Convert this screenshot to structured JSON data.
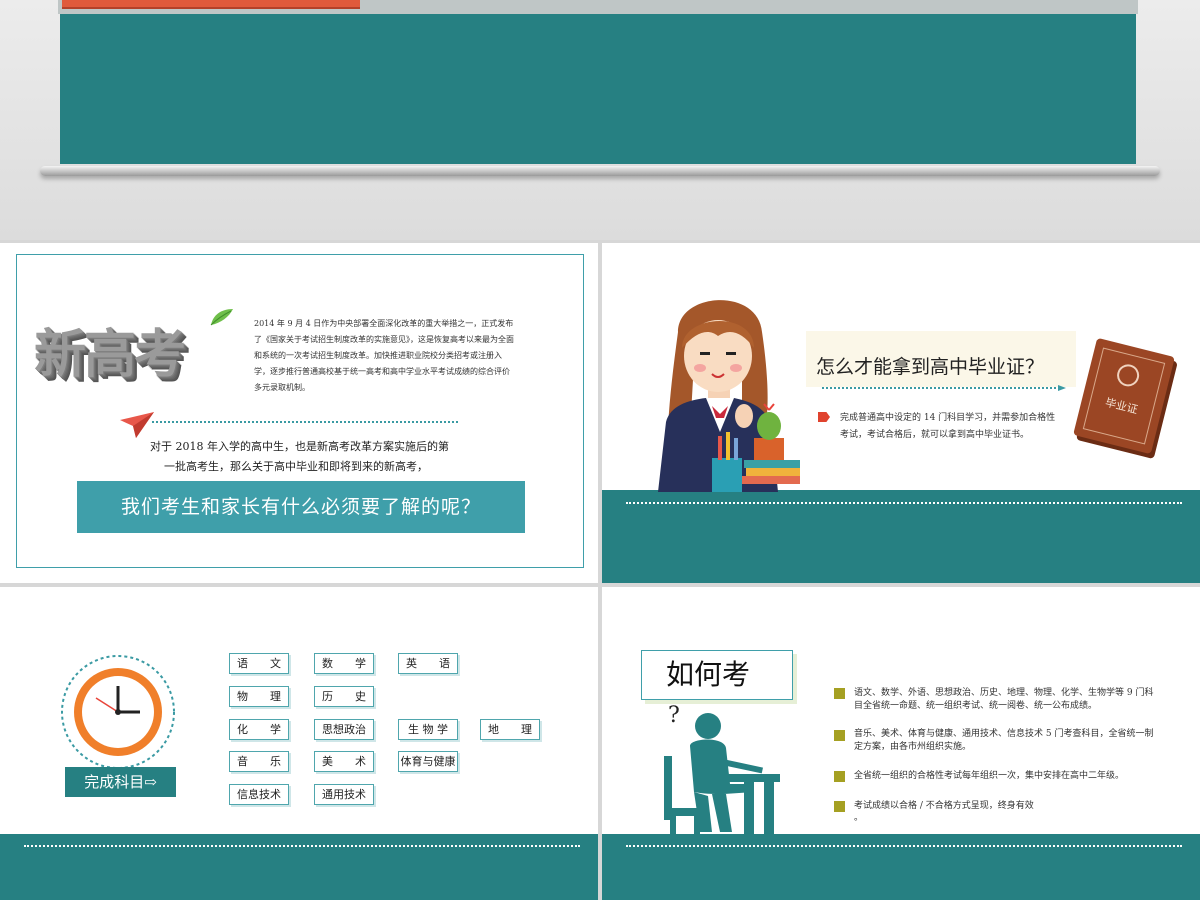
{
  "colors": {
    "teal": "#268082",
    "teal_light": "#3f9faa",
    "red": "#e0432e",
    "olive": "#a5a022"
  },
  "slide1": {
    "logo": "新高考",
    "paragraph": "2014 年 9 月 4 日作为中央部署全面深化改革的重大举措之一，正式发布了《国家关于考试招生制度改革的实施意见》，这是恢复高考以来最为全面和系统的一次考试招生制度改革。加快推进职业院校分类招考或注册入学，逐步推行普通高校基于统一高考和高中学业水平考试成绩的综合评价多元录取机制。",
    "body_line1": "对于 2018 年入学的高中生，也是新高考改革方案实施后的第",
    "body_line2": "一批高考生，那么关于高中毕业和即将到来的新高考，",
    "banner": "我们考生和家长有什么必须要了解的呢？"
  },
  "slide2": {
    "question": "怎么才能拿到高中毕业证？",
    "text": "完成普通高中设定的 14 门科目学习，并需参加合格性考试，考试合格后，就可以拿到高中毕业证书。",
    "certificate": "毕业证"
  },
  "slide3": {
    "label": "完成科目⇨",
    "subjects": [
      "语　　文",
      "数　　学",
      "英　　语",
      "物　　理",
      "历　　史",
      "化　　学",
      "思想政治",
      "生 物 学",
      "地　　理",
      "音　　乐",
      "美　　术",
      "体育与健康",
      "信息技术",
      "通用技术"
    ]
  },
  "slide4": {
    "title": "如何考",
    "question_mark": "?",
    "items": [
      "语文、数学、外语、思想政治、历史、地理、物理、化学、生物学等 9 门科目全省统一命题、统一组织考试、统一阅卷、统一公布成绩。",
      "音乐、美术、体育与健康、通用技术、信息技术 5 门考查科目，全省统一制定方案，由各市州组织实施。",
      "全省统一组织的合格性考试每年组织一次，集中安排在高中二年级。",
      "考试成绩以合格 / 不合格方式呈现，终身有效",
      "。"
    ]
  }
}
